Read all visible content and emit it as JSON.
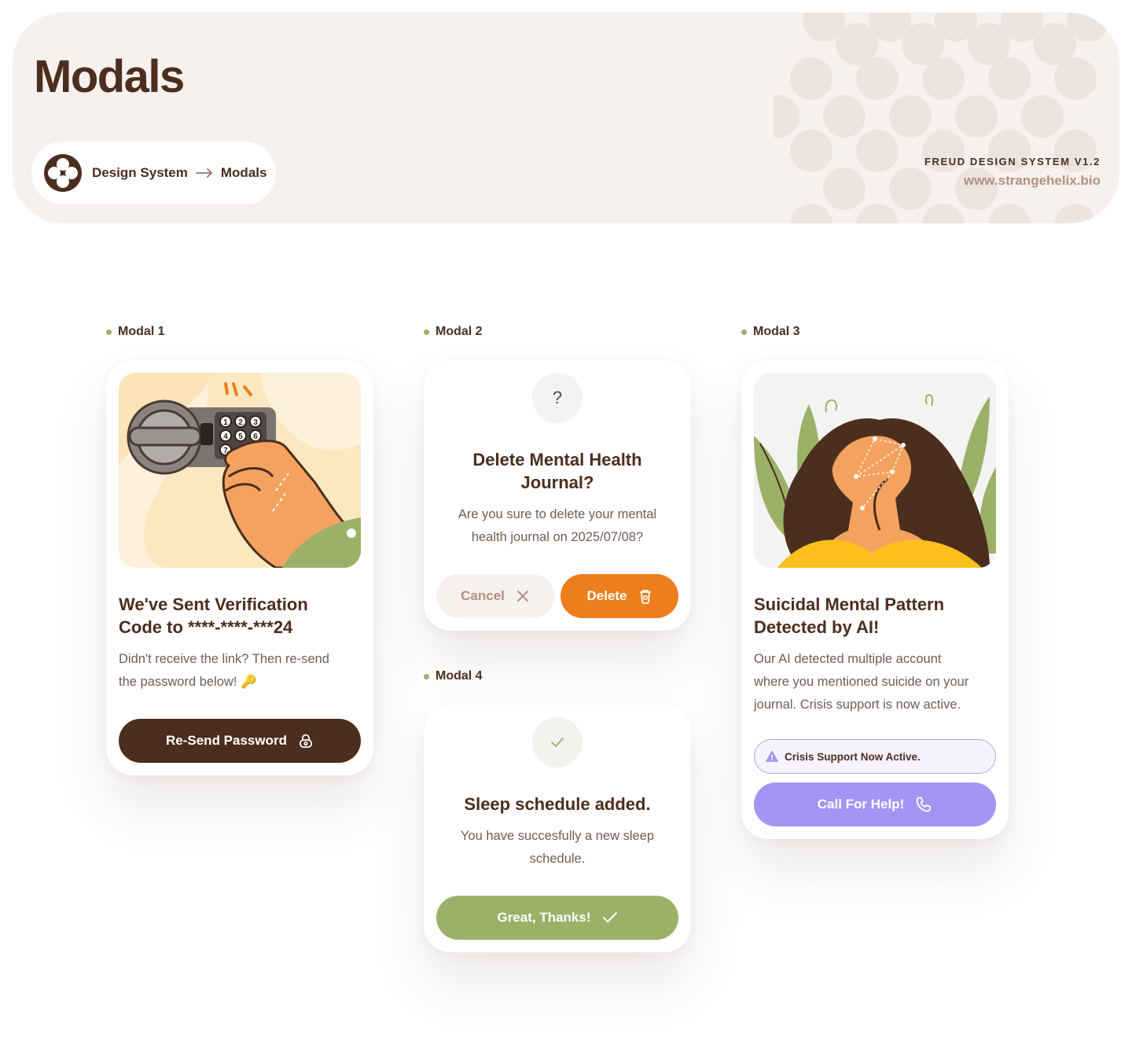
{
  "header": {
    "title": "Modals",
    "breadcrumb": {
      "root": "Design System",
      "current": "Modals"
    },
    "brand": "FREUD DESIGN SYSTEM V1.2",
    "website": "www.strangehelix.bio"
  },
  "modal1": {
    "label": "Modal 1",
    "title_line1": "We've Sent Verification",
    "title_line2": "Code to ****-****-***24",
    "body_line1": "Didn't receive the link? Then re-send",
    "body_line2": "the password below! 🔑",
    "button": "Re-Send Password",
    "keypad": [
      "1",
      "2",
      "3",
      "4",
      "5",
      "6",
      "7"
    ],
    "colors": {
      "button": "#4b2e1e"
    }
  },
  "modal2": {
    "label": "Modal 2",
    "icon_glyph": "?",
    "title_line1": "Delete Mental Health",
    "title_line2": "Journal?",
    "body_line1": "Are you sure to delete your mental",
    "body_line2": "health journal on 2025/07/08?",
    "cancel": "Cancel",
    "delete": "Delete",
    "colors": {
      "delete": "#ed7e1c",
      "cancel_bg": "#f6f1ee",
      "cancel_text": "#b4907f"
    }
  },
  "modal3": {
    "label": "Modal 3",
    "title_line1": "Suicidal Mental Pattern",
    "title_line2": "Detected by AI!",
    "body_line1": "Our AI detected multiple account",
    "body_line2": "where you mentioned suicide on your",
    "body_line3": "journal. Crisis support is now active.",
    "alert": "Crisis Support Now Active.",
    "button": "Call For Help!",
    "colors": {
      "button": "#a694f5",
      "alert_border": "#b6a4ef"
    }
  },
  "modal4": {
    "label": "Modal 4",
    "title": "Sleep schedule added.",
    "body_line1": "You have succesfully a new sleep",
    "body_line2": "schedule.",
    "button": "Great, Thanks!",
    "colors": {
      "button": "#9bb168"
    }
  }
}
